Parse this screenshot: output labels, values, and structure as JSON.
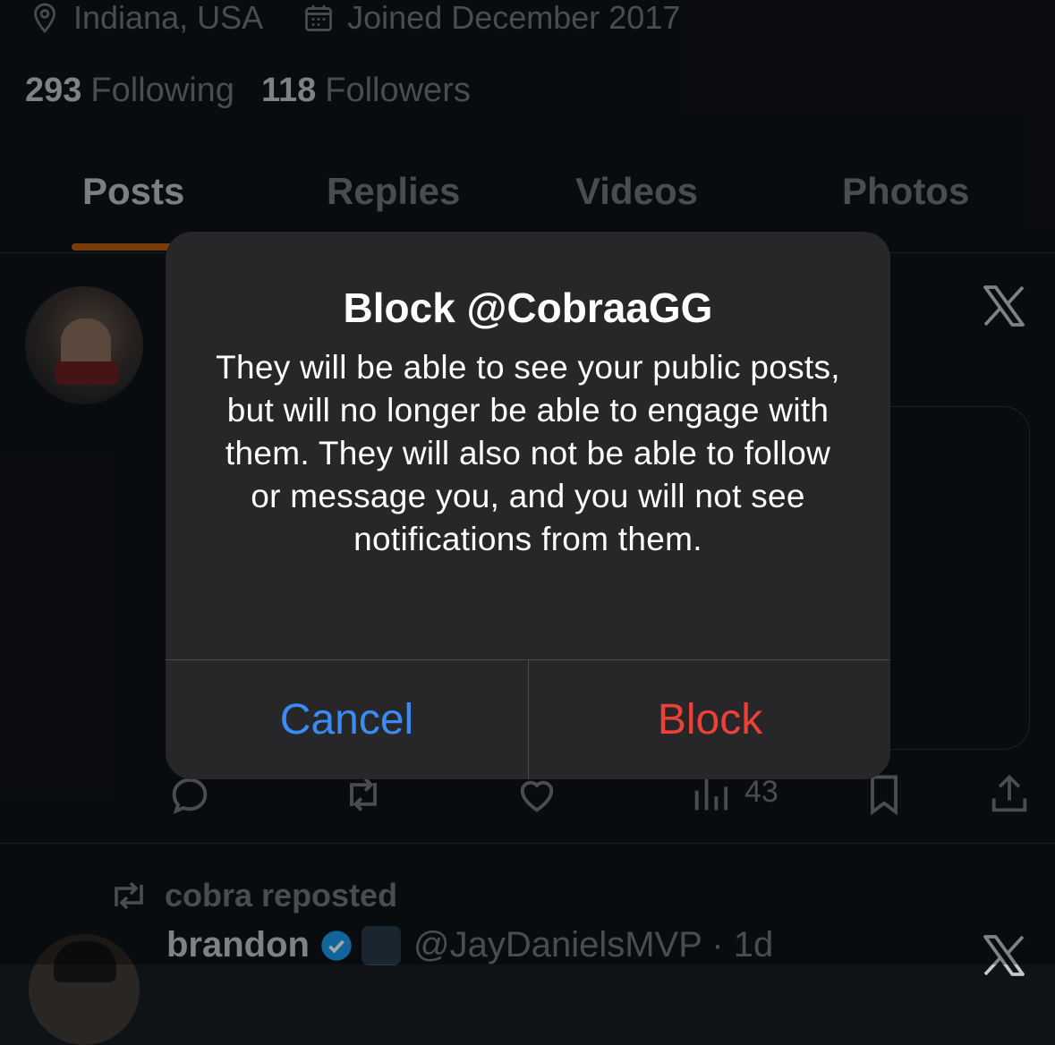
{
  "profile": {
    "location": "Indiana, USA",
    "joined": "Joined December 2017",
    "following_count": "293",
    "following_label": "Following",
    "followers_count": "118",
    "followers_label": "Followers"
  },
  "tabs": [
    {
      "label": "Posts",
      "active": true
    },
    {
      "label": "Replies",
      "active": false
    },
    {
      "label": "Videos",
      "active": false
    },
    {
      "label": "Photos",
      "active": false
    }
  ],
  "post": {
    "views": "43"
  },
  "repost": {
    "label": "cobra reposted",
    "author_name": "brandon",
    "author_handle": "@JayDanielsMVP · 1d"
  },
  "dialog": {
    "title": "Block @CobraaGG",
    "message": "They will be able to see your public posts, but will no longer be able to engage with them. They will also not be able to follow or message you, and you will not see notifications from them.",
    "cancel_label": "Cancel",
    "block_label": "Block"
  },
  "colors": {
    "cancel": "#3a8cf5",
    "block": "#ee4037",
    "tab_indicator": "#b55c10"
  }
}
